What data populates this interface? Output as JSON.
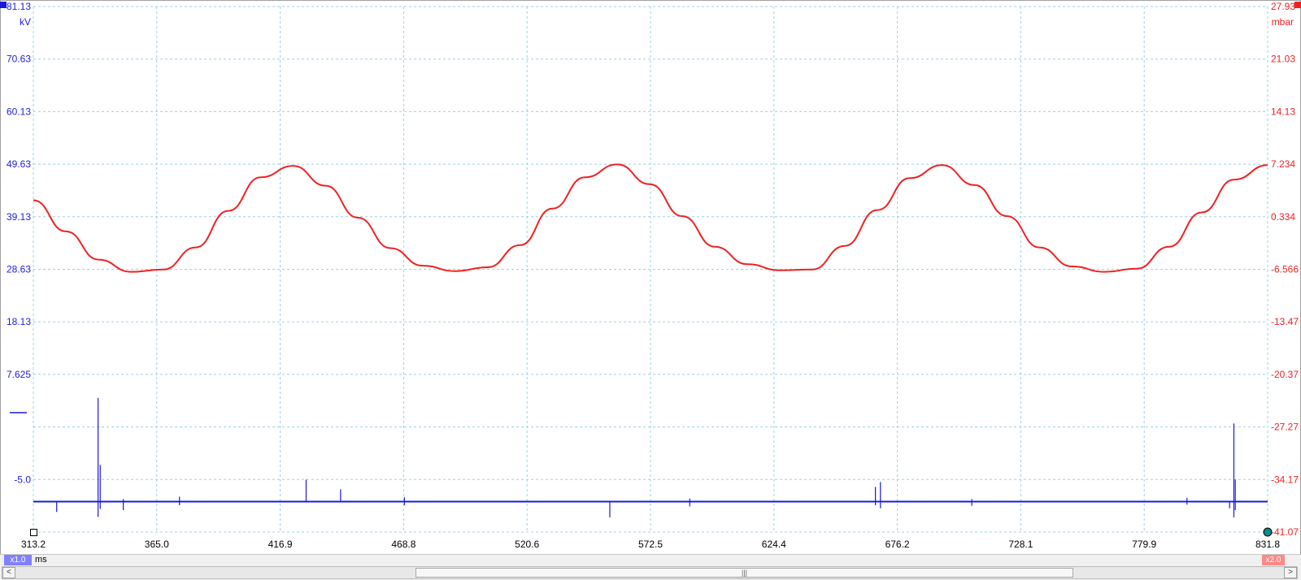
{
  "chart_data": {
    "type": "line",
    "x_unit": "ms",
    "x_ticks": [
      "313.2",
      "365.0",
      "416.9",
      "468.8",
      "520.6",
      "572.5",
      "624.4",
      "676.2",
      "728.1",
      "779.9",
      "831.8"
    ],
    "xlim": [
      313.2,
      831.8
    ],
    "grid": true,
    "left_axis": {
      "unit": "kV",
      "color": "#2020dd",
      "ticks": [
        "81.13",
        "70.63",
        "60.13",
        "49.63",
        "39.13",
        "28.63",
        "18.13",
        "7.625",
        "",
        "-5.0"
      ],
      "ylim": [
        -5.0,
        81.13
      ]
    },
    "right_axis": {
      "unit": "mbar",
      "color": "#ee2222",
      "ticks": [
        "27.93",
        "21.03",
        "14.13",
        "7.234",
        "0.334",
        "-6.566",
        "-13.47",
        "-20.37",
        "-27.27",
        "-34.17",
        "-41.07"
      ],
      "ylim": [
        -41.07,
        27.93
      ]
    },
    "series": [
      {
        "axis": "right",
        "color": "#ee2222",
        "x": [
          313.2,
          326.9,
          340.6,
          354.2,
          367.8,
          381.4,
          395.1,
          408.7,
          422.4,
          436.0,
          449.6,
          463.2,
          476.8,
          490.4,
          504.1,
          517.7,
          531.3,
          544.9,
          558.6,
          572.2,
          585.9,
          599.5,
          613.2,
          626.8,
          640.5,
          654.1,
          667.8,
          681.4,
          695.0,
          708.6,
          722.3,
          735.9,
          749.6,
          763.2,
          776.8,
          790.4,
          804.1,
          817.7,
          831.8
        ],
        "values": [
          2.5,
          -1.6,
          -5.3,
          -6.9,
          -6.6,
          -3.7,
          1.1,
          5.5,
          7.0,
          4.4,
          0.2,
          -3.8,
          -6.1,
          -6.8,
          -6.3,
          -3.4,
          1.4,
          5.5,
          7.2,
          4.6,
          0.4,
          -3.6,
          -5.9,
          -6.7,
          -6.6,
          -3.5,
          1.2,
          5.4,
          7.1,
          4.5,
          0.4,
          -3.7,
          -6.2,
          -6.9,
          -6.5,
          -3.6,
          0.9,
          5.2,
          7.1
        ]
      },
      {
        "axis": "left",
        "color": "#1a1adc",
        "baseline": 0.0,
        "spikes": [
          {
            "x": 323.0,
            "min": -1.7,
            "max": 0.0
          },
          {
            "x": 340.4,
            "min": -2.5,
            "max": 17.0
          },
          {
            "x": 341.3,
            "min": -1.2,
            "max": 6.0
          },
          {
            "x": 351.0,
            "min": -1.4,
            "max": 0.4
          },
          {
            "x": 374.6,
            "min": -0.6,
            "max": 0.8
          },
          {
            "x": 427.8,
            "min": 0.0,
            "max": 3.6
          },
          {
            "x": 442.3,
            "min": 0.0,
            "max": 2.0
          },
          {
            "x": 469.1,
            "min": -0.6,
            "max": 0.7
          },
          {
            "x": 555.4,
            "min": -2.6,
            "max": 0.0
          },
          {
            "x": 589.0,
            "min": -0.8,
            "max": 0.5
          },
          {
            "x": 667.0,
            "min": -0.6,
            "max": 2.4
          },
          {
            "x": 669.1,
            "min": -1.1,
            "max": 3.2
          },
          {
            "x": 707.5,
            "min": -0.7,
            "max": 0.4
          },
          {
            "x": 797.9,
            "min": -0.5,
            "max": 0.6
          },
          {
            "x": 815.8,
            "min": -1.1,
            "max": 0.0
          },
          {
            "x": 817.6,
            "min": -2.6,
            "max": 12.8
          },
          {
            "x": 818.2,
            "min": -1.4,
            "max": 3.6
          }
        ]
      }
    ]
  },
  "controls": {
    "left_scale_badge": "x1.0",
    "right_scale_badge": "x2.0",
    "scroll_thumb_grip": "|||",
    "scroll_left_arrow": "<",
    "scroll_right_arrow": ">"
  }
}
